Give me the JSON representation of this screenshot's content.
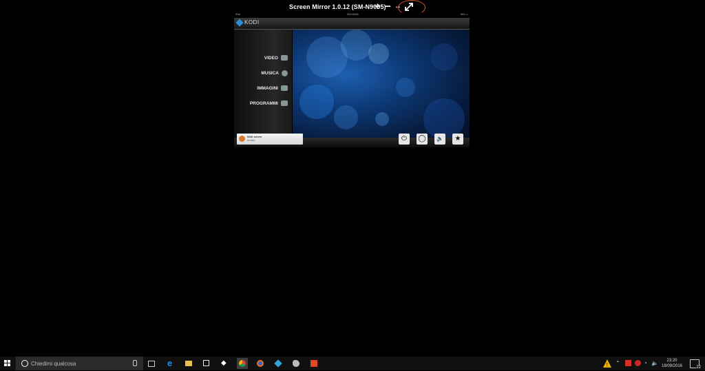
{
  "app": {
    "title": "Screen Mirror 1.0.12 (SM-N9005)",
    "controls": {
      "zoom_in": "+",
      "zoom_out": "−",
      "fit": "↔",
      "fullscreen": "⤢"
    },
    "annotation_color": "#e0572a"
  },
  "phone": {
    "statusbar": {
      "left": "iPad",
      "center": "SM-N9005",
      "right": "96% ▭"
    },
    "kodi": {
      "logo": "KODI",
      "menu": [
        {
          "label": "VIDEO",
          "icon": "film-icon"
        },
        {
          "label": "MUSICA",
          "icon": "music-disc-icon"
        },
        {
          "label": "IMMAGINI",
          "icon": "picture-icon"
        },
        {
          "label": "PROGRAMMI",
          "icon": "gamepad-icon"
        }
      ],
      "notification": {
        "title": "Web server",
        "subtitle": "Avviato"
      },
      "buttons": [
        {
          "name": "power-icon",
          "glyph": "⏻"
        },
        {
          "name": "refresh-icon",
          "glyph": "◯"
        },
        {
          "name": "volume-icon",
          "glyph": "🔈"
        },
        {
          "name": "favourite-icon",
          "glyph": "★"
        }
      ]
    }
  },
  "taskbar": {
    "search_placeholder": "Chiedimi qualcosa",
    "apps": [
      "task-view-icon",
      "edge-icon",
      "file-explorer-icon",
      "store-icon",
      "dropbox-icon",
      "chrome-icon",
      "firefox-icon",
      "kodi-icon",
      "app-icon",
      "calendar-app-icon"
    ],
    "clock": {
      "time": "23:20",
      "date": "18/09/2016"
    },
    "notifications_count": "22"
  }
}
